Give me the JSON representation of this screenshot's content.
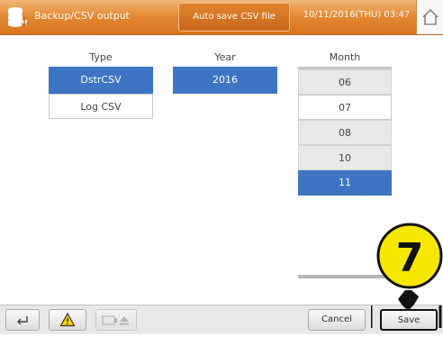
{
  "header": {
    "title": "Backup/CSV output",
    "tab_label": "Auto save CSV file",
    "datetime": "10/11/2016(THU) 03:47",
    "home_icon": "home-icon",
    "app_icon": "database-icon"
  },
  "type_column": {
    "heading": "Type",
    "items": [
      {
        "label": "DstrCSV",
        "selected": true
      },
      {
        "label": "Log CSV",
        "selected": false
      }
    ]
  },
  "year_column": {
    "heading": "Year",
    "items": [
      {
        "label": "2016",
        "selected": true
      }
    ]
  },
  "month_column": {
    "heading": "Month",
    "items": [
      {
        "label": "06",
        "selected": false
      },
      {
        "label": "07",
        "selected": false
      },
      {
        "label": "08",
        "selected": false
      },
      {
        "label": "10",
        "selected": false
      },
      {
        "label": "11",
        "selected": true
      }
    ]
  },
  "footer": {
    "back_icon": "back-arrow-icon",
    "warning_icon": "warning-icon",
    "media_icon": "media-eject-icon",
    "cancel_label": "Cancel",
    "save_label": "Save"
  },
  "annotation": {
    "step_number": "7"
  },
  "colors": {
    "header_orange": "#e58a35",
    "selection_blue": "#3d75c4",
    "callout_yellow": "#f7e600"
  }
}
